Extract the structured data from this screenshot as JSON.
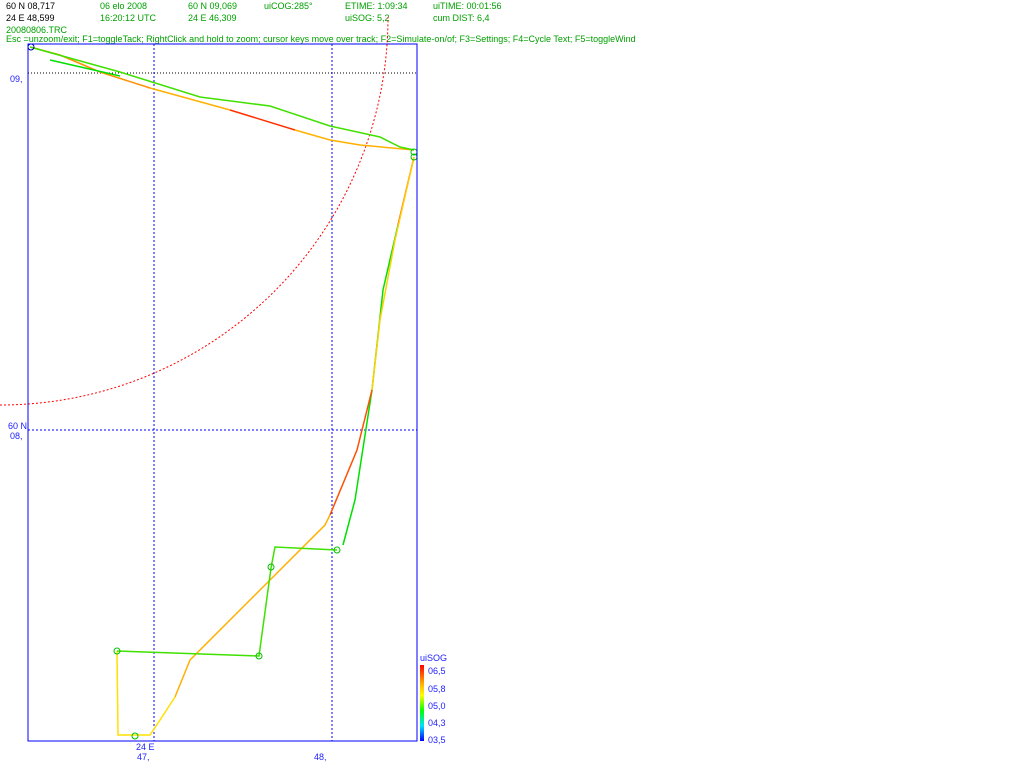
{
  "status": {
    "lat": "60 N 08,717",
    "lon": "24 E 48,599",
    "date": "06 elo 2008",
    "time": "16:20:12 UTC",
    "cursor_lat": "60 N 09,069",
    "cursor_lon": "24 E 46,309",
    "cog": "uiCOG:285°",
    "sog": "uiSOG: 5,2",
    "etime": "ETIME: 1:09:34",
    "uitime": "uiTIME: 00:01:56",
    "cumdist": "cum DIST: 6,4",
    "file": "20080806.TRC",
    "help": "Esc =unzoom/exit; F1=toggleTack; RightClick and hold to zoom; cursor keys move over track; F2=Simulate-on/of; F3=Settings; F4=Cycle Text; F5=toggleWind"
  },
  "axes": {
    "lat_label_top": "09,",
    "lat_label_mid_1": "60 N",
    "lat_label_mid_2": "08,",
    "lon_label_left_1": "24 E",
    "lon_label_left_2": "47,",
    "lon_label_right": "48,"
  },
  "legend": {
    "title": "uiSOG",
    "ticks": [
      "06,5",
      "05,8",
      "05,0",
      "04,3",
      "03,5"
    ]
  },
  "colors": {
    "frame": "#0000ff",
    "grid": "#0000ff",
    "circle": "#ff0000",
    "marker": "#00c000"
  }
}
